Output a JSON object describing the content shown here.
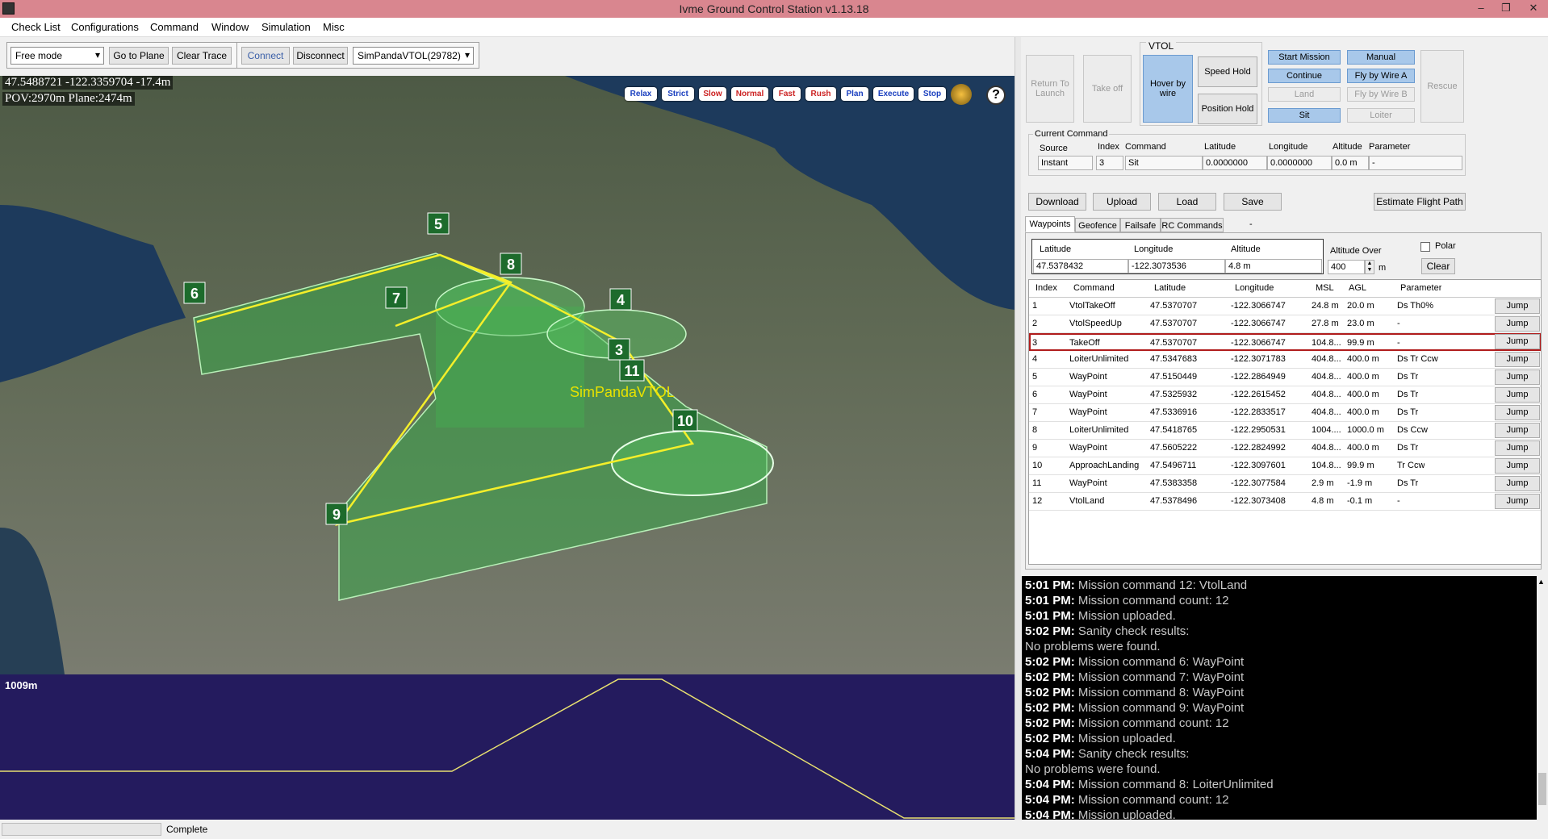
{
  "window": {
    "title": "Ivme Ground Control Station v1.13.18"
  },
  "menu": [
    "Check List",
    "Configurations",
    "Command",
    "Window",
    "Simulation",
    "Misc"
  ],
  "toolbar": {
    "mode_value": "Free mode",
    "go_to_plane": "Go to Plane",
    "clear_trace": "Clear Trace",
    "connect": "Connect",
    "disconnect": "Disconnect",
    "vehicle_value": "SimPandaVTOL(29782)"
  },
  "map": {
    "coord_readout": "47.5488721 -122.3359704 -17.4m",
    "pov_readout": "POV:2970m Plane:2474m",
    "pills": [
      {
        "label": "Relax",
        "color": "#1a3fbf"
      },
      {
        "label": "Strict",
        "color": "#1a3fbf"
      },
      {
        "label": "Slow",
        "color": "#cc2222"
      },
      {
        "label": "Normal",
        "color": "#cc2222"
      },
      {
        "label": "Fast",
        "color": "#cc2222"
      },
      {
        "label": "Rush",
        "color": "#cc2222"
      },
      {
        "label": "Plan",
        "color": "#1a3fbf"
      },
      {
        "label": "Execute",
        "color": "#1a3fbf"
      },
      {
        "label": "Stop",
        "color": "#1a3fbf"
      }
    ],
    "help_icon": "?",
    "markers": [
      "3",
      "4",
      "5",
      "6",
      "7",
      "8",
      "9",
      "10",
      "11"
    ],
    "vehicle_label": "SimPandaVTOL",
    "water_color": "#1d3a5c"
  },
  "profile": {
    "altitude_label": "1009m"
  },
  "status": {
    "text": "Complete"
  },
  "flight_buttons": {
    "return_to_launch": "Return To Launch",
    "take_off": "Take off",
    "vtol_label": "VTOL",
    "hover_by_wire": "Hover by wire",
    "speed_hold": "Speed Hold",
    "position_hold": "Position Hold",
    "start_mission": "Start Mission",
    "continue": "Continue",
    "land": "Land",
    "sit": "Sit",
    "manual": "Manual",
    "fly_by_wire_a": "Fly by Wire A",
    "fly_by_wire_b": "Fly by Wire B",
    "loiter": "Loiter",
    "rescue": "Rescue"
  },
  "current_command": {
    "group_label": "Current Command",
    "headers": [
      "Source",
      "Index",
      "Command",
      "Latitude",
      "Longitude",
      "Altitude",
      "Parameter"
    ],
    "values": [
      "Instant",
      "3",
      "Sit",
      "0.0000000",
      "0.0000000",
      "0.0 m",
      "-"
    ]
  },
  "actions": {
    "download": "Download",
    "upload": "Upload",
    "load": "Load",
    "save": "Save",
    "estimate": "Estimate Flight Path",
    "dash": "-"
  },
  "tabs": [
    "Waypoints",
    "Geofence",
    "Failsafe",
    "RC Commands"
  ],
  "new_waypoint": {
    "lat_label": "Latitude",
    "lon_label": "Longitude",
    "alt_label": "Altitude",
    "lat": "47.5378432",
    "lon": "-122.3073536",
    "alt": "4.8 m",
    "alt_over_label": "Altitude Over",
    "alt_over_value": "400",
    "unit": "m",
    "polar_label": "Polar",
    "clear": "Clear"
  },
  "waypoints": {
    "headers": [
      "Index",
      "Command",
      "Latitude",
      "Longitude",
      "MSL",
      "AGL",
      "Parameter"
    ],
    "jump_label": "Jump",
    "rows": [
      [
        "1",
        "VtolTakeOff",
        "47.5370707",
        "-122.3066747",
        "24.8 m",
        "20.0 m",
        "Ds Th0%"
      ],
      [
        "2",
        "VtolSpeedUp",
        "47.5370707",
        "-122.3066747",
        "27.8 m",
        "23.0 m",
        "-"
      ],
      [
        "3",
        "TakeOff",
        "47.5370707",
        "-122.3066747",
        "104.8...",
        "99.9 m",
        "-"
      ],
      [
        "4",
        "LoiterUnlimited",
        "47.5347683",
        "-122.3071783",
        "404.8...",
        "400.0 m",
        "Ds Tr Ccw"
      ],
      [
        "5",
        "WayPoint",
        "47.5150449",
        "-122.2864949",
        "404.8...",
        "400.0 m",
        "Ds Tr"
      ],
      [
        "6",
        "WayPoint",
        "47.5325932",
        "-122.2615452",
        "404.8...",
        "400.0 m",
        "Ds Tr"
      ],
      [
        "7",
        "WayPoint",
        "47.5336916",
        "-122.2833517",
        "404.8...",
        "400.0 m",
        "Ds Tr"
      ],
      [
        "8",
        "LoiterUnlimited",
        "47.5418765",
        "-122.2950531",
        "1004....",
        "1000.0 m",
        "Ds Ccw"
      ],
      [
        "9",
        "WayPoint",
        "47.5605222",
        "-122.2824992",
        "404.8...",
        "400.0 m",
        "Ds Tr"
      ],
      [
        "10",
        "ApproachLanding",
        "47.5496711",
        "-122.3097601",
        "104.8...",
        "99.9 m",
        "Tr Ccw"
      ],
      [
        "11",
        "WayPoint",
        "47.5383358",
        "-122.3077584",
        "2.9 m",
        "-1.9 m",
        "Ds Tr"
      ],
      [
        "12",
        "VtolLand",
        "47.5378496",
        "-122.3073408",
        "4.8 m",
        "-0.1 m",
        "-"
      ]
    ]
  },
  "log": [
    {
      "time": "5:01 PM:",
      "msg": "Mission command 12: VtolLand"
    },
    {
      "time": "5:01 PM:",
      "msg": "Mission command count: 12"
    },
    {
      "time": "5:01 PM:",
      "msg": "Mission uploaded."
    },
    {
      "time": "5:02 PM:",
      "msg": "Sanity check results:"
    },
    {
      "time": "",
      "msg": "No problems were found."
    },
    {
      "time": "5:02 PM:",
      "msg": "Mission command 6: WayPoint"
    },
    {
      "time": "5:02 PM:",
      "msg": "Mission command 7: WayPoint"
    },
    {
      "time": "5:02 PM:",
      "msg": "Mission command 8: WayPoint"
    },
    {
      "time": "5:02 PM:",
      "msg": "Mission command 9: WayPoint"
    },
    {
      "time": "5:02 PM:",
      "msg": "Mission command count: 12"
    },
    {
      "time": "5:02 PM:",
      "msg": "Mission uploaded."
    },
    {
      "time": "5:04 PM:",
      "msg": "Sanity check results:"
    },
    {
      "time": "",
      "msg": "No problems were found."
    },
    {
      "time": "5:04 PM:",
      "msg": "Mission command 8: LoiterUnlimited"
    },
    {
      "time": "5:04 PM:",
      "msg": "Mission command count: 12"
    },
    {
      "time": "5:04 PM:",
      "msg": "Mission uploaded."
    }
  ]
}
